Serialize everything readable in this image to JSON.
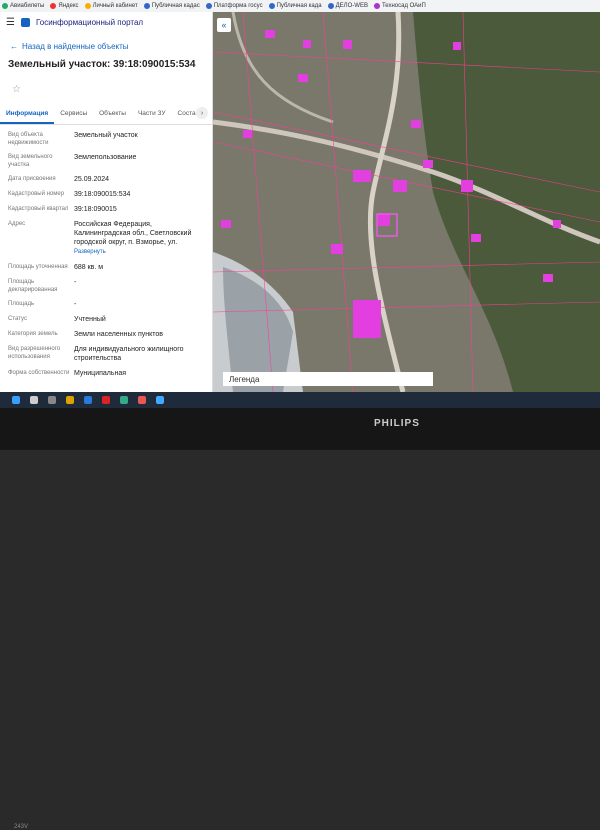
{
  "bookmarks": [
    {
      "label": "Авиабилеты",
      "color": "#2a6"
    },
    {
      "label": "Яндекс",
      "color": "#e33"
    },
    {
      "label": "Личный кабинет",
      "color": "#fa0"
    },
    {
      "label": "Публичная кадас",
      "color": "#36c"
    },
    {
      "label": "Платформа госус",
      "color": "#36c"
    },
    {
      "label": "Публичная када",
      "color": "#36c"
    },
    {
      "label": "ДЕЛО-WEB",
      "color": "#36c"
    },
    {
      "label": "Техносад ОАиП",
      "color": "#a3c"
    }
  ],
  "app": {
    "title": "Госинформационный портал"
  },
  "nav": {
    "back_label": "Назад в найденные объекты"
  },
  "object": {
    "title": "Земельный участок: 39:18:090015:534"
  },
  "tabs": [
    "Информация",
    "Сервисы",
    "Объекты",
    "Части ЗУ",
    "Соста"
  ],
  "fields": [
    {
      "key": "Вид объекта недвижимости",
      "value": "Земельный участок"
    },
    {
      "key": "Вид земельного участка",
      "value": "Землепользование"
    },
    {
      "key": "Дата присвоения",
      "value": "25.09.2024"
    },
    {
      "key": "Кадастровый номер",
      "value": "39:18:090015:534"
    },
    {
      "key": "Кадастровый квартал",
      "value": "39:18:090015"
    },
    {
      "key": "Адрес",
      "value": "Российская Федерация, Калининградская обл., Светловский городской округ, п. Взморье, ул.",
      "link": "Развернуть"
    },
    {
      "key": "Площадь уточненная",
      "value": "688 кв. м"
    },
    {
      "key": "Площадь декларированная",
      "value": "-"
    },
    {
      "key": "Площадь",
      "value": "-"
    },
    {
      "key": "Статус",
      "value": "Учтенный"
    },
    {
      "key": "Категория земель",
      "value": "Земли населенных пунктов"
    },
    {
      "key": "Вид разрешенного использования",
      "value": "Для индивидуального жилищного строительства"
    },
    {
      "key": "Форма собственности",
      "value": "Муниципальная"
    }
  ],
  "map": {
    "legend_label": "Легенда"
  },
  "monitor": {
    "brand": "PHILIPS",
    "model": "243V"
  }
}
